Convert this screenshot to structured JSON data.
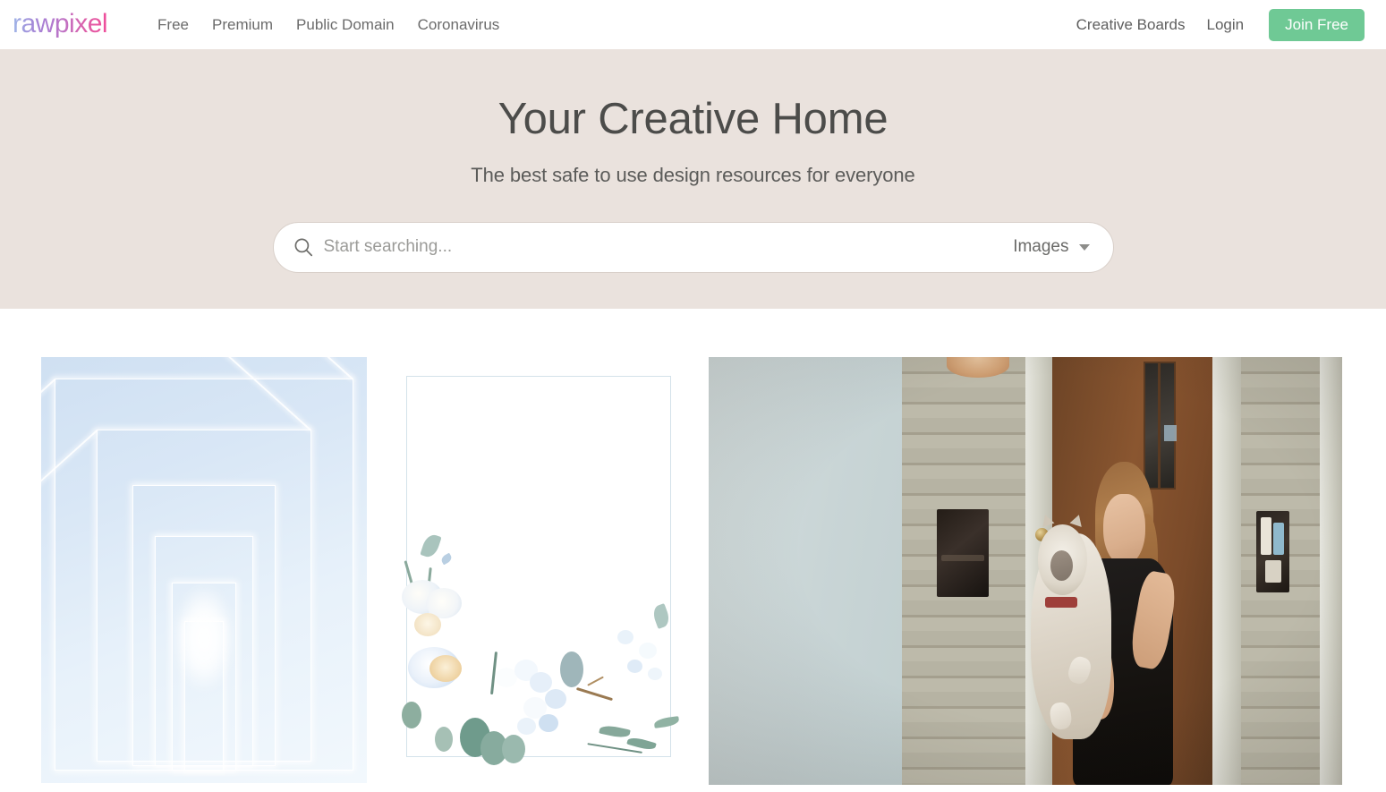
{
  "header": {
    "logo_text": "rawpixel",
    "nav_left": [
      {
        "label": "Free"
      },
      {
        "label": "Premium"
      },
      {
        "label": "Public Domain"
      },
      {
        "label": "Coronavirus"
      }
    ],
    "nav_right": [
      {
        "label": "Creative Boards"
      },
      {
        "label": "Login"
      }
    ],
    "join_button_label": "Join Free",
    "join_button_color": "#6fc995"
  },
  "hero": {
    "title": "Your Creative Home",
    "subtitle": "The best safe to use design resources for everyone",
    "background_color": "#eae2dd",
    "search": {
      "icon": "search-icon",
      "placeholder": "Start searching...",
      "value": "",
      "type_selector_label": "Images",
      "type_selector_icon": "chevron-down-icon"
    }
  },
  "gallery": {
    "items": [
      {
        "id": "corridor",
        "alt": "Bright white and blue abstract perspective corridor with glowing light at the end"
      },
      {
        "id": "floral-frame",
        "alt": "Watercolor floral frame with white and blue blossoms and green eucalyptus leaves"
      },
      {
        "id": "doorway-cat",
        "alt": "Young woman in a black dress holding a fluffy cat in a house doorway"
      }
    ]
  }
}
